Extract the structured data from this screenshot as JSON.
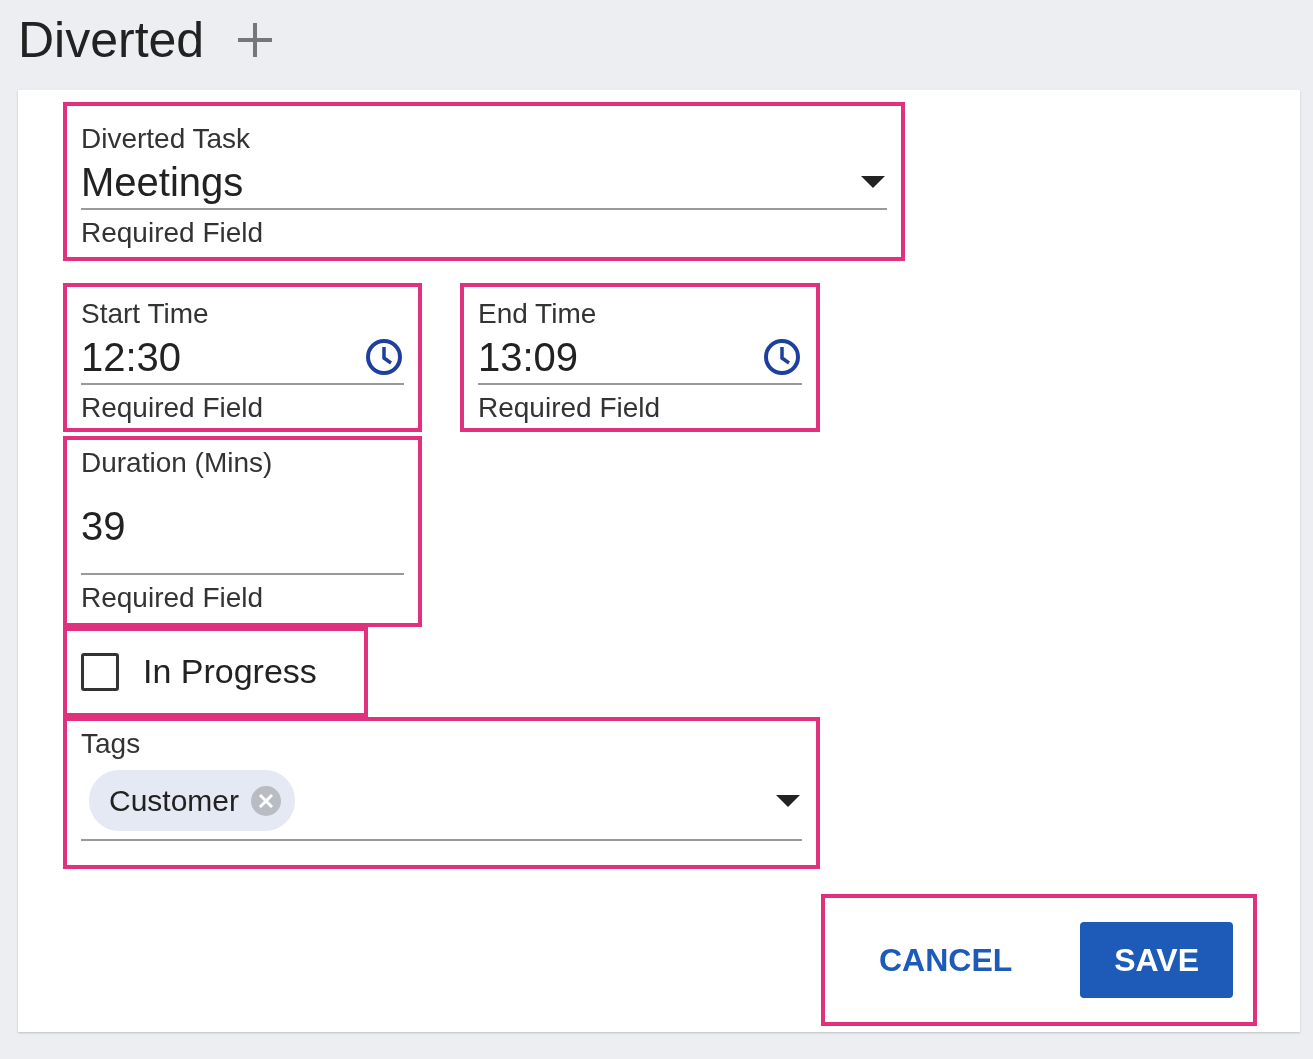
{
  "header": {
    "title": "Diverted"
  },
  "task_field": {
    "label": "Diverted Task",
    "value": "Meetings",
    "helper": "Required Field"
  },
  "start_time": {
    "label": "Start Time",
    "value": "12:30",
    "helper": "Required Field"
  },
  "end_time": {
    "label": "End Time",
    "value": "13:09",
    "helper": "Required Field"
  },
  "duration": {
    "label": "Duration (Mins)",
    "value": "39",
    "helper": "Required Field"
  },
  "in_progress": {
    "label": "In Progress",
    "checked": false
  },
  "tags": {
    "label": "Tags",
    "chips": [
      {
        "label": "Customer"
      }
    ]
  },
  "buttons": [
    {
      "label": "CANCEL",
      "kind": "text"
    },
    {
      "label": "SAVE",
      "kind": "primary"
    }
  ]
}
